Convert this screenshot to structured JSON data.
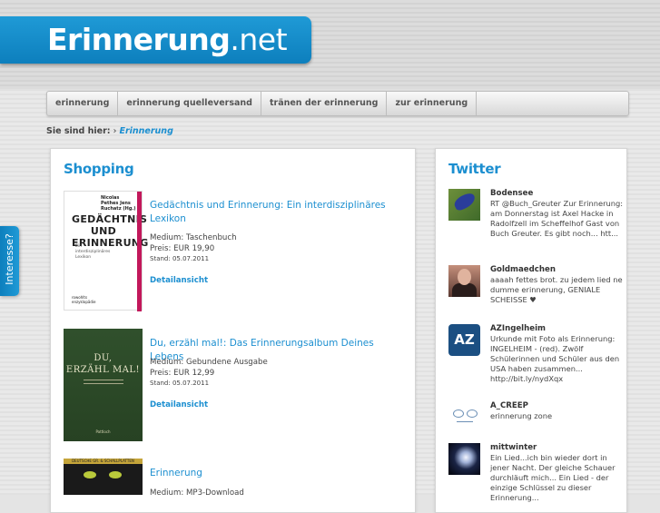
{
  "logo": {
    "bold": "Erinnerung",
    "light": ".net"
  },
  "nav": [
    "erinnerung",
    "erinnerung quelleversand",
    "tränen der erinnerung",
    "zur erinnerung"
  ],
  "breadcrumb": {
    "label": "Sie sind hier:",
    "separator": "›",
    "current": "Erinnerung"
  },
  "side_tab": "Interesse?",
  "shopping": {
    "heading": "Shopping",
    "products": [
      {
        "title": "Gedächtnis und Erinnerung: Ein interdisziplinäres Lexikon",
        "medium": "Medium: Taschenbuch",
        "price": "Preis: EUR 19,90",
        "stand": "Stand: 05.07.2011",
        "link": "Detailansicht",
        "cover": {
          "editors": "Nicolas Pethes Jens Ruchatz (Hg.)",
          "title_line1": "GEDÄCHTNIS",
          "title_line2": "UND",
          "title_line3": "ERINNERUNG",
          "subtitle": "Ein interdisziplinäres Lexikon",
          "publisher": "rowohlts enzyklopädie"
        }
      },
      {
        "title": "Du, erzähl mal!: Das Erinnerungsalbum Deines Lebens",
        "medium": "Medium: Gebundene Ausgabe",
        "price": "Preis: EUR 12,99",
        "stand": "Stand: 05.07.2011",
        "link": "Detailansicht",
        "cover": {
          "title_line1": "DU,",
          "title_line2": "ERZÄHL MAL!",
          "publisher": "Pattloch"
        }
      },
      {
        "title": "Erinnerung",
        "medium": "Medium: MP3-Download",
        "cover": {
          "band": "DEUTSCHE GR. & SCHALLPLATTEN"
        }
      }
    ]
  },
  "twitter": {
    "heading": "Twitter",
    "tweets": [
      {
        "user": "Bodensee",
        "text": "RT @Buch_Greuter Zur Erinnerung: am Donnerstag ist Axel Hacke in Radolfzell im Scheffelhof Gast von Buch Greuter. Es gibt noch... htt..."
      },
      {
        "user": "Goldmaedchen",
        "text": "aaaah fettes brot. zu jedem lied ne dumme erinnerung, GENIALE SCHEISSE ♥"
      },
      {
        "user": "AZIngelheim",
        "avatar_text": "AZ",
        "text": "Urkunde mit Foto als Erinnerung: INGELHEIM - (red). Zwölf Schülerinnen und Schüler aus den USA haben zusammen... http://bit.ly/nydXqx"
      },
      {
        "user": "A_CREEP",
        "text": "erinnerung zone"
      },
      {
        "user": "mittwinter",
        "text": "Ein Lied...ich bin wieder dort in jener Nacht. Der gleiche Schauer durchläuft mich... Ein Lied - der einzige Schlüssel zu dieser Erinnerung..."
      }
    ]
  }
}
